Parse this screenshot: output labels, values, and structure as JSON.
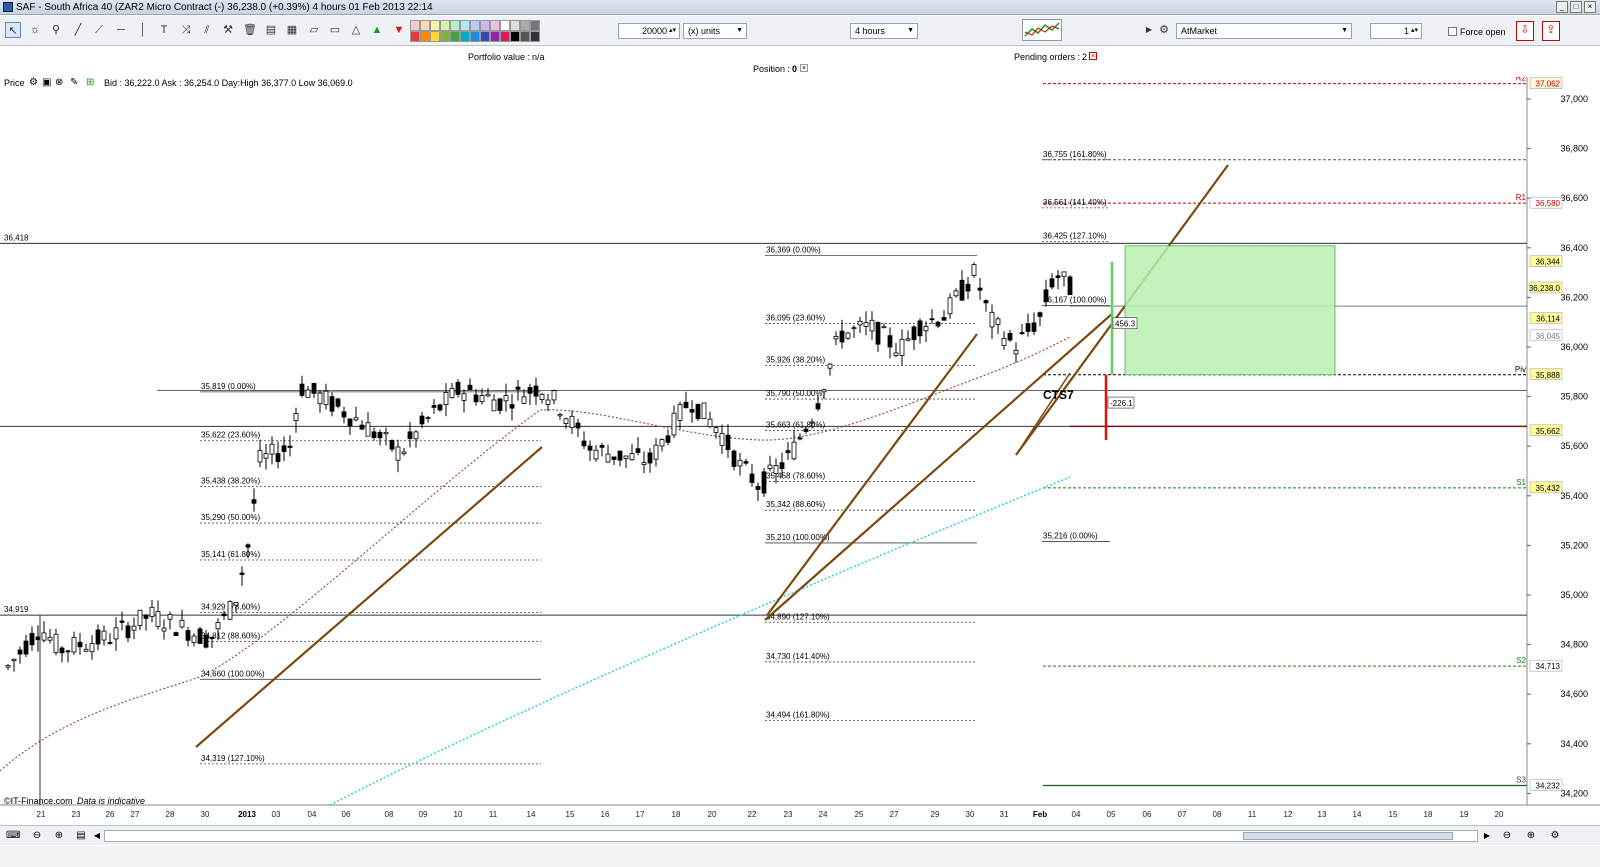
{
  "window": {
    "title": "SAF - South Africa 40 (ZAR2 Micro Contract (-)   36,238.0 (+0.39%)   4 hours  01 Feb 2013 22:14",
    "buttons": [
      "_",
      "□",
      "×"
    ]
  },
  "toolbar": {
    "quantity": "20000",
    "units": "(x) units",
    "timeframe": "4 hours",
    "order_type": "AtMarket",
    "order_qty": "1",
    "force_open_label": "Force open",
    "palette": [
      "#f7c9c9",
      "#f9d9b0",
      "#fbf4a8",
      "#d8f2b0",
      "#b6eecb",
      "#b2e7ef",
      "#b9c9f3",
      "#cbbaf1",
      "#f0bde4",
      "#ffffff",
      "#dddddd",
      "#aaaaaa",
      "#777777",
      "#e53935",
      "#fb8c00",
      "#fdd835",
      "#7cb342",
      "#43a047",
      "#00acc1",
      "#1e88e5",
      "#3949ab",
      "#8e24aa",
      "#d81b60",
      "#000000",
      "#555555",
      "#333333"
    ]
  },
  "info": {
    "portfolio_label": "Portfolio value :",
    "portfolio_value": "n/a",
    "position_label": "Position :",
    "position_value": "0",
    "pending_label": "Pending orders :",
    "pending_value": "2",
    "price_label": "Price",
    "quote": "Bid : 36,222.0 Ask : 36,254.0 Day:High 36,377.0 Low 36,069.0",
    "footer": "©IT-Finance.com",
    "footer_note": "Data is indicative"
  },
  "chart_data": {
    "type": "candlestick",
    "instrument": "SAF - South Africa 40",
    "timeframe": "4 hours",
    "y_axis": {
      "min": 34200,
      "max": 37100,
      "ticks": [
        "37,000",
        "36,800",
        "36,600",
        "36,400",
        "36,200",
        "36,000",
        "35,800",
        "35,600",
        "35,400",
        "35,200",
        "35,000",
        "34,800",
        "34,600",
        "34,400",
        "34,200"
      ]
    },
    "x_axis": {
      "labels": [
        "21",
        "23",
        "26",
        "27",
        "28",
        "30",
        "2013",
        "03",
        "04",
        "06",
        "08",
        "09",
        "10",
        "11",
        "14",
        "15",
        "16",
        "17",
        "18",
        "20",
        "22",
        "23",
        "24",
        "25",
        "27",
        "29",
        "30",
        "31",
        "Feb",
        "04",
        "05",
        "06",
        "07",
        "08",
        "11",
        "12",
        "13",
        "14",
        "15",
        "18",
        "19",
        "20"
      ]
    },
    "price_tags": [
      {
        "value": "37,062",
        "color": "#fff7d6",
        "text_color": "#c00000"
      },
      {
        "value": "36,580",
        "color": "#ffffff",
        "text_color": "#c00000"
      },
      {
        "value": "36,344",
        "color": "#fffc9c",
        "text_color": "#000000"
      },
      {
        "value": "36,238.0",
        "color": "#fffc9c",
        "text_color": "#000000"
      },
      {
        "value": "36,114",
        "color": "#fffc9c",
        "text_color": "#000000"
      },
      {
        "value": "36,045",
        "color": "#ffffff",
        "text_color": "#777777"
      },
      {
        "value": "35,888",
        "color": "#fffc9c",
        "text_color": "#000000"
      },
      {
        "value": "35,662",
        "color": "#fffc9c",
        "text_color": "#000000"
      },
      {
        "value": "35,432",
        "color": "#fffc9c",
        "text_color": "#000000"
      },
      {
        "value": "34,713",
        "color": "#ffffff",
        "text_color": "#000000"
      },
      {
        "value": "34,232",
        "color": "#ffffff",
        "text_color": "#000000"
      }
    ],
    "levels_left": [
      "36,418",
      "34,919"
    ],
    "pivot_labels": [
      "R2",
      "R1",
      "Piv",
      "S1",
      "S2",
      "S3"
    ],
    "fib_set_1": [
      "35,819 (0.00%)",
      "35,622 (23.60%)",
      "35,438 (38.20%)",
      "35,290 (50.00%)",
      "35,141 (61.80%)",
      "34,929 (78.60%)",
      "34,812 (88.60%)",
      "34,660 (100.00%)",
      "34,319 (127.10%)"
    ],
    "fib_set_2": [
      "36,369 (0.00%)",
      "36,095 (23.60%)",
      "35,926 (38.20%)",
      "35,790 (50.00%)",
      "35,663 (61.80%)",
      "35,458 (78.60%)",
      "35,342 (88.60%)",
      "35,210 (100.00%)",
      "34,890 (127.10%)",
      "34,730 (141.40%)",
      "34,494 (161.80%)"
    ],
    "fib_set_3": [
      "36,755 (161.80%)",
      "36,561 (141.40%)",
      "36,425 (127.10%)",
      "36,167 (100.00%)",
      "35,216 (0.00%)"
    ],
    "annotations": [
      "CTS7",
      "456.3",
      "-226.1"
    ]
  }
}
